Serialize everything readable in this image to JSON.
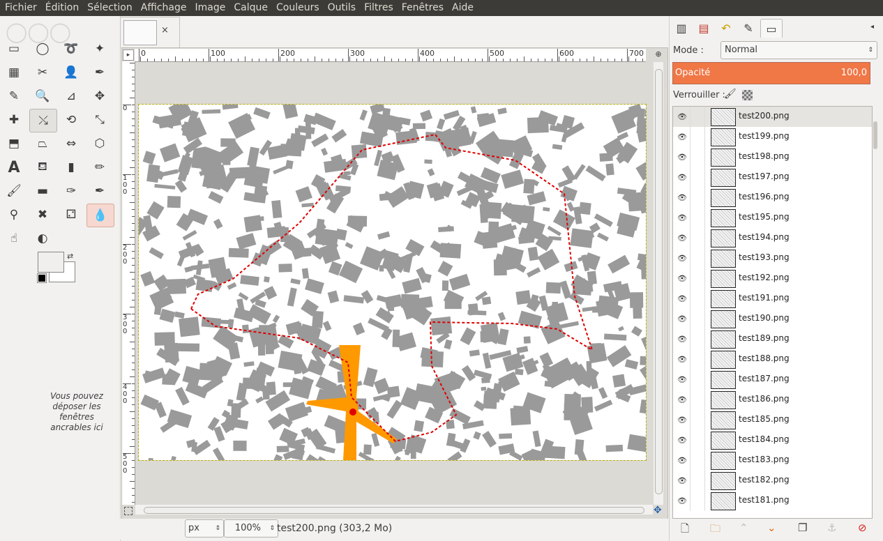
{
  "menu": [
    "Fichier",
    "Édition",
    "Sélection",
    "Affichage",
    "Image",
    "Calque",
    "Couleurs",
    "Outils",
    "Filtres",
    "Fenêtres",
    "Aide"
  ],
  "toolbox": {
    "tools": [
      [
        "rect-select-icon",
        "ellipse-select-icon",
        "free-select-icon",
        "fuzzy-select-icon"
      ],
      [
        "color-select-icon",
        "scissors-icon",
        "foreground-select-icon",
        "paths-icon"
      ],
      [
        "color-picker-icon",
        "zoom-icon",
        "measure-icon",
        "move-icon"
      ],
      [
        "align-icon",
        "transform-icon",
        "rotate-icon",
        "scale-icon"
      ],
      [
        "shear-icon",
        "perspective-icon",
        "flip-icon",
        "cage-transform-icon"
      ],
      [
        "text-icon",
        "bucket-fill-icon",
        "blend-icon",
        "pencil-icon"
      ],
      [
        "paintbrush-icon",
        "eraser-icon",
        "airbrush-icon",
        "ink-icon"
      ],
      [
        "clone-icon",
        "heal-icon",
        "perspective-clone-icon",
        "blur-icon"
      ],
      [
        "smudge-icon",
        "dodge-burn-icon"
      ]
    ],
    "drop_note": "Vous pouvez déposer les fenêtres ancrables ici"
  },
  "image_window": {
    "tab_close": "×",
    "hruler_labels": [
      "0",
      "100",
      "200",
      "300",
      "400",
      "500",
      "600",
      "700"
    ],
    "vruler_labels": [
      "0",
      "100",
      "200",
      "300",
      "400",
      "500"
    ],
    "unit": "px",
    "zoom": "100%",
    "status": "test200.png (303,2 Mo)"
  },
  "dock": {
    "mode_label": "Mode :",
    "mode_value": "Normal",
    "opacity_label": "Opacité",
    "opacity_value": "100,0",
    "lock_label": "Verrouiller :",
    "layers": [
      "test200.png",
      "test199.png",
      "test198.png",
      "test197.png",
      "test196.png",
      "test195.png",
      "test194.png",
      "test193.png",
      "test192.png",
      "test191.png",
      "test190.png",
      "test189.png",
      "test188.png",
      "test187.png",
      "test186.png",
      "test185.png",
      "test184.png",
      "test183.png",
      "test182.png",
      "test181.png"
    ]
  },
  "colors": {
    "accent": "#f07746",
    "menubar": "#3c3b37",
    "buildings": "#9a9a9a",
    "route": "#e00000",
    "marker": "#ff9900"
  }
}
